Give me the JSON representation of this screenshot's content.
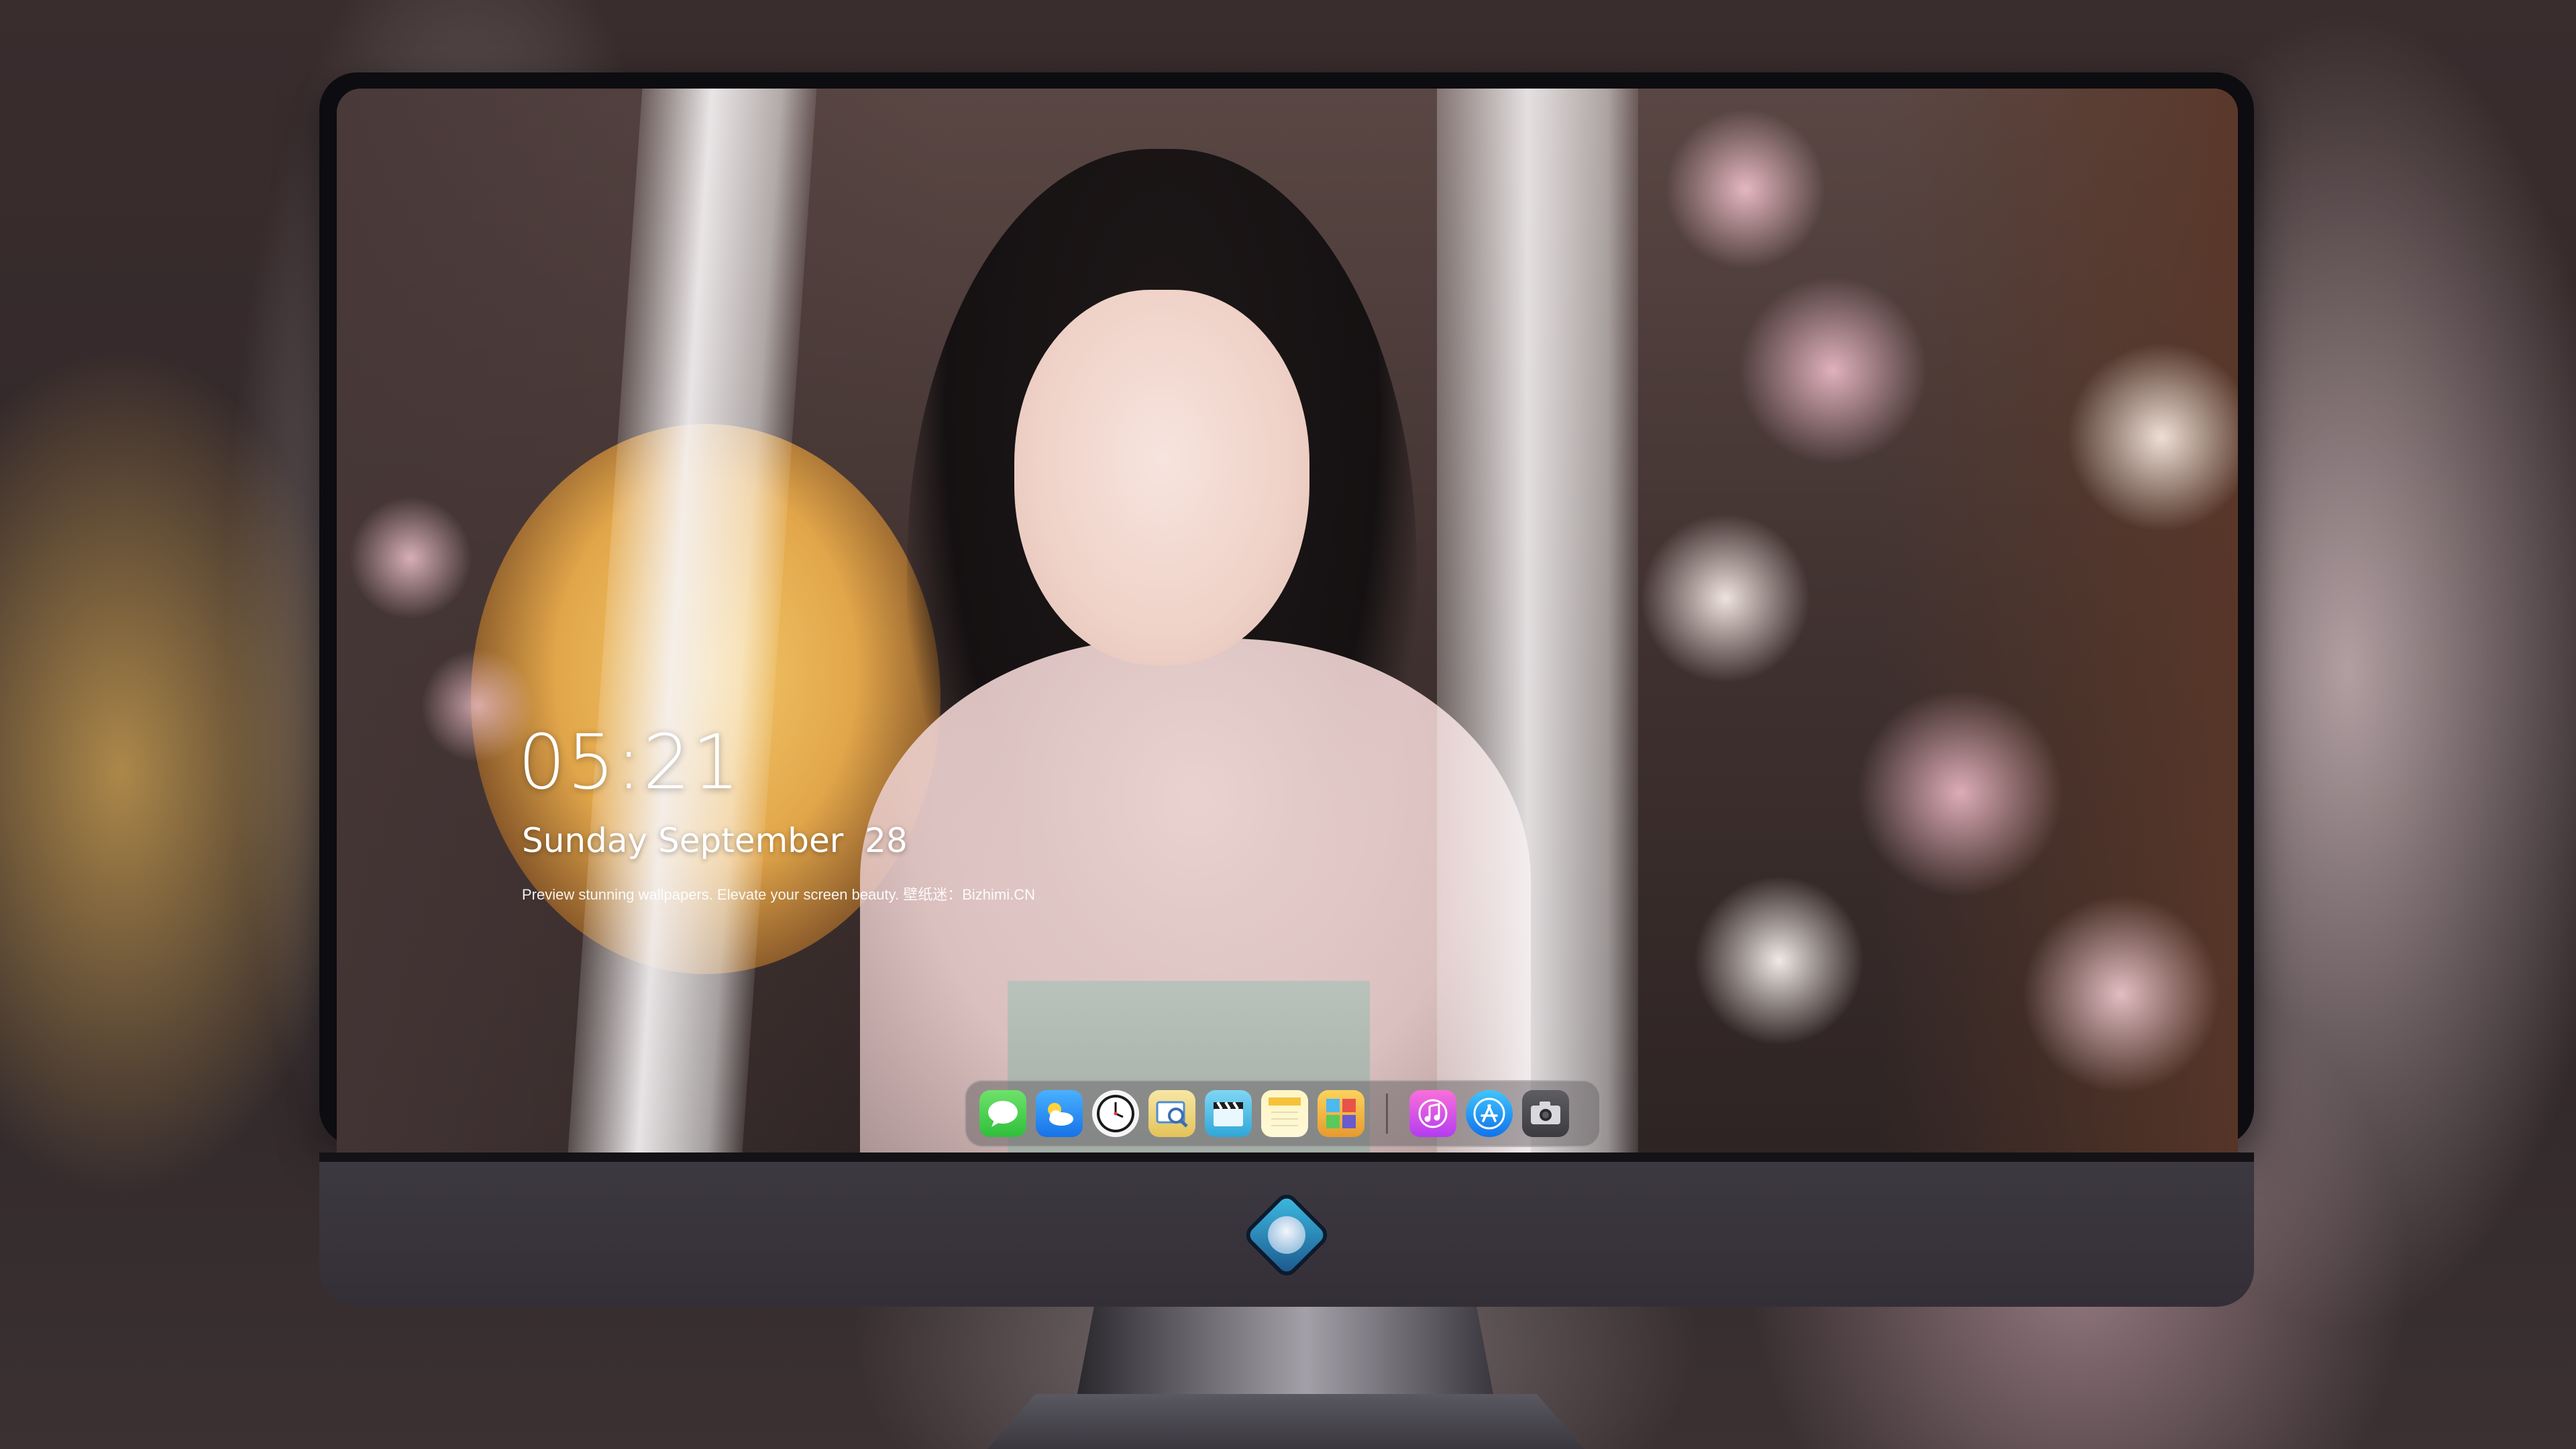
{
  "lock_screen": {
    "time": "05:21",
    "date": "Sunday September  28",
    "tagline": "Preview stunning wallpapers. Elevate your screen beauty. 壁纸迷：Bizhimi.CN"
  },
  "dock": {
    "apps": [
      {
        "name": "Messages",
        "icon": "messages-icon"
      },
      {
        "name": "Weather",
        "icon": "weather-icon"
      },
      {
        "name": "Clock",
        "icon": "clock-icon"
      },
      {
        "name": "Preview",
        "icon": "preview-icon"
      },
      {
        "name": "Videos",
        "icon": "clapperboard-icon"
      },
      {
        "name": "Notes",
        "icon": "notes-icon"
      },
      {
        "name": "Photo Booth",
        "icon": "photo-booth-icon"
      },
      {
        "name": "Music",
        "icon": "music-note-icon"
      },
      {
        "name": "App Store",
        "icon": "app-store-icon"
      },
      {
        "name": "Camera",
        "icon": "camera-icon"
      }
    ]
  },
  "colors": {
    "monitor_chin": "#3d3941",
    "dock_background": "#6e686c",
    "clock_text": "#ffffff"
  }
}
